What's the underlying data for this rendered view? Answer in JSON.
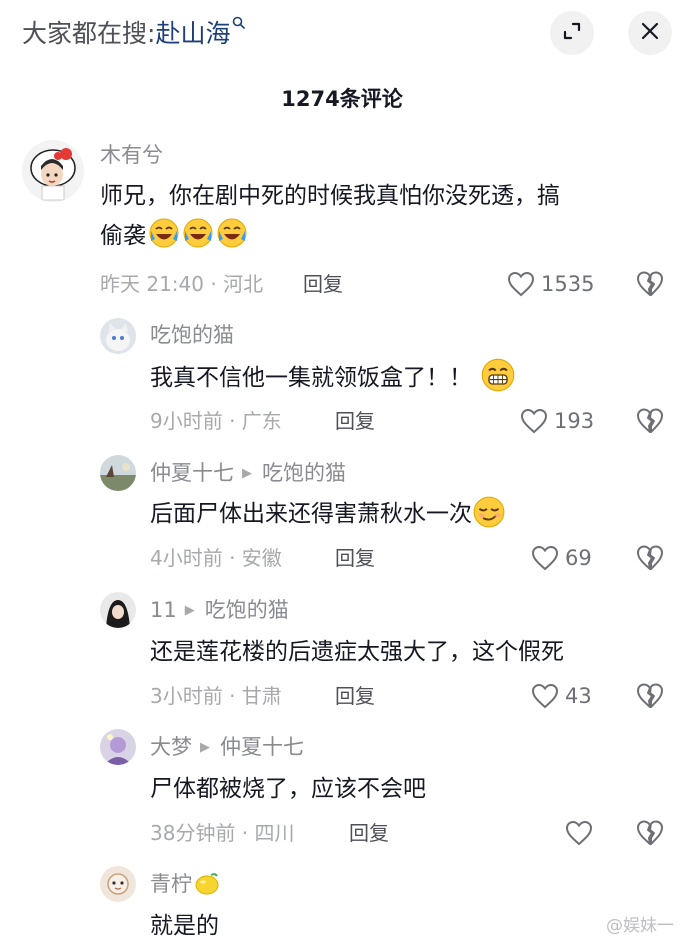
{
  "header": {
    "search_prefix": "大家都在搜:",
    "search_keyword": "赴山海",
    "icons": [
      "search-icon",
      "expand-icon",
      "close-icon"
    ]
  },
  "comment_count": "1274条评论",
  "comments": [
    {
      "user": "木有兮",
      "text_line1": "师兄，你在剧中死的时候我真怕你没死透，搞",
      "text_line2": "偷袭",
      "emojis": [
        "crying-laugh-emoji",
        "crying-laugh-emoji",
        "crying-laugh-emoji"
      ],
      "meta": "昨天 21:40 · 河北",
      "reply_label": "回复",
      "likes": "1535"
    }
  ],
  "replies": [
    {
      "user": "吃饱的猫",
      "reply_to": "",
      "text": "我真不信他一集就领饭盒了！！",
      "emoji": "grinning-emoji",
      "meta": "9小时前 · 广东",
      "reply_label": "回复",
      "likes": "193"
    },
    {
      "user": "仲夏十七",
      "reply_to": "吃饱的猫",
      "text": "后面尸体出来还得害萧秋水一次",
      "emoji": "smirk-emoji",
      "meta": "4小时前 · 安徽",
      "reply_label": "回复",
      "likes": "69"
    },
    {
      "user": "11",
      "reply_to": "吃饱的猫",
      "text": "还是莲花楼的后遗症太强大了，这个假死",
      "emoji": "",
      "meta": "3小时前 · 甘肃",
      "reply_label": "回复",
      "likes": "43"
    },
    {
      "user": "大梦",
      "reply_to": "仲夏十七",
      "text": "尸体都被烧了，应该不会吧",
      "emoji": "",
      "meta": "38分钟前 · 四川",
      "reply_label": "回复",
      "likes": ""
    },
    {
      "user": "青柠",
      "reply_to": "",
      "text": "就是的",
      "emoji": "",
      "meta": "",
      "reply_label": "",
      "likes": ""
    }
  ],
  "watermark": "@娱妹一",
  "colors": {
    "keyword": "#1f3f7a",
    "muted": "#a8a9ad",
    "text": "#161823"
  }
}
